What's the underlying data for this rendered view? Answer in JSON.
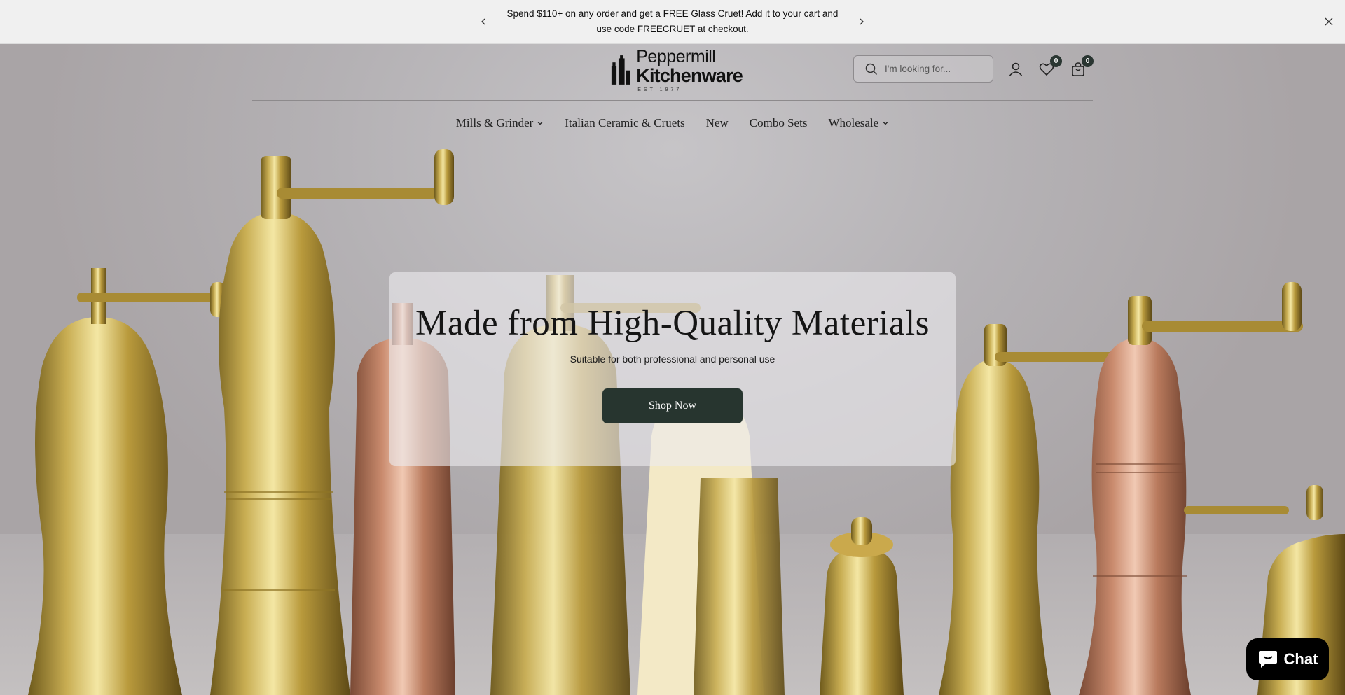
{
  "announcement": {
    "text": "Spend $110+ on any order and get a FREE Glass Cruet! Add it to your cart and use code FREECRUET at checkout.",
    "prev_icon": "chevron-left-icon",
    "next_icon": "chevron-right-icon",
    "close_icon": "close-icon"
  },
  "header": {
    "logo": {
      "line1": "Peppermill",
      "line2": "Kitchenware",
      "line3": "EST 1977"
    },
    "search": {
      "placeholder": "I'm looking for...",
      "value": ""
    },
    "wishlist_count": "0",
    "cart_count": "0",
    "icons": [
      "search-icon",
      "account-icon",
      "heart-icon",
      "shopping-bag-icon"
    ]
  },
  "nav": {
    "items": [
      {
        "label": "Mills & Grinder",
        "has_dropdown": true
      },
      {
        "label": "Italian Ceramic & Cruets",
        "has_dropdown": false
      },
      {
        "label": "New",
        "has_dropdown": false
      },
      {
        "label": "Combo Sets",
        "has_dropdown": false
      },
      {
        "label": "Wholesale",
        "has_dropdown": true
      }
    ]
  },
  "hero": {
    "title": "Made from High-Quality Materials",
    "subtitle": "Suitable for both professional and personal use",
    "cta_label": "Shop Now"
  },
  "chat": {
    "label": "Chat"
  },
  "colors": {
    "announcement_bg": "#f0f0f0",
    "primary_button": "#27352f",
    "badge": "#2a3632",
    "chat_bg": "#000000"
  }
}
